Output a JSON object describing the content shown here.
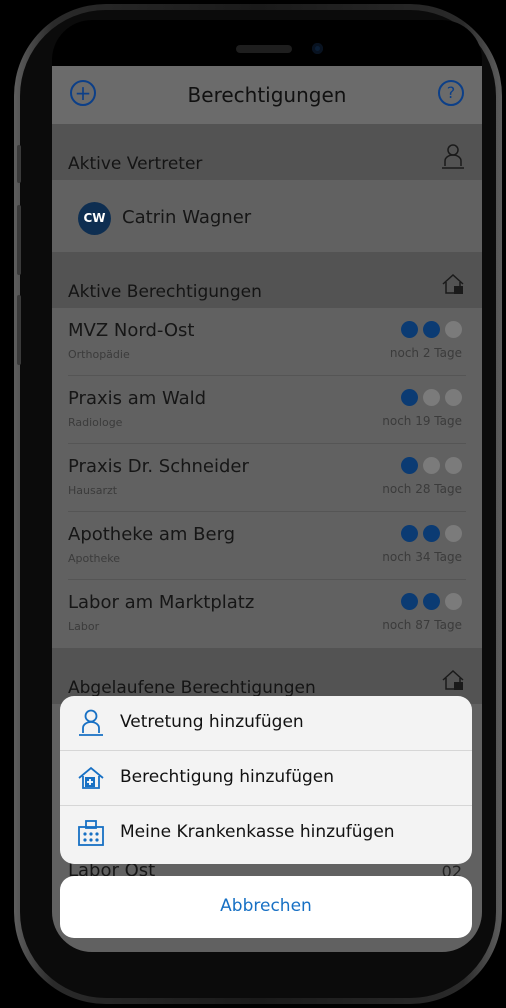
{
  "header": {
    "title": "Berechtigungen",
    "add_label": "+",
    "help_label": "?"
  },
  "sections": {
    "active_representatives": {
      "title": "Aktive Vertreter",
      "icon": "person-icon"
    },
    "active_permissions": {
      "title": "Aktive Berechtigungen",
      "icon": "house-key-icon"
    },
    "expired_permissions": {
      "title": "Abgelaufene Berechtigungen",
      "icon": "house-key-icon"
    }
  },
  "representative": {
    "initials": "CW",
    "name": "Catrin Wagner"
  },
  "permissions": [
    {
      "name": "MVZ Nord-Ost",
      "type": "Orthopädie",
      "remaining": "noch 2 Tage",
      "level": 2
    },
    {
      "name": "Praxis am Wald",
      "type": "Radiologe",
      "remaining": "noch 19 Tage",
      "level": 1
    },
    {
      "name": "Praxis Dr. Schneider",
      "type": "Hausarzt",
      "remaining": "noch 28 Tage",
      "level": 1
    },
    {
      "name": "Apotheke am Berg",
      "type": "Apotheke",
      "remaining": "noch 34 Tage",
      "level": 2
    },
    {
      "name": "Labor am Marktplatz",
      "type": "Labor",
      "remaining": "noch 87 Tage",
      "level": 2
    }
  ],
  "expired_partial": {
    "name": "Labor Ost",
    "value": "02"
  },
  "action_sheet": {
    "items": [
      {
        "label": "Vetretung hinzufügen",
        "icon": "person-icon"
      },
      {
        "label": "Berechtigung hinzufügen",
        "icon": "house-plus-icon"
      },
      {
        "label": "Meine Krankenkasse hinzufügen",
        "icon": "hospital-icon"
      }
    ],
    "cancel_label": "Abbrechen"
  },
  "colors": {
    "accent": "#1770c4",
    "dot_on": "#0b3b73",
    "avatar": "#0e2e51"
  }
}
